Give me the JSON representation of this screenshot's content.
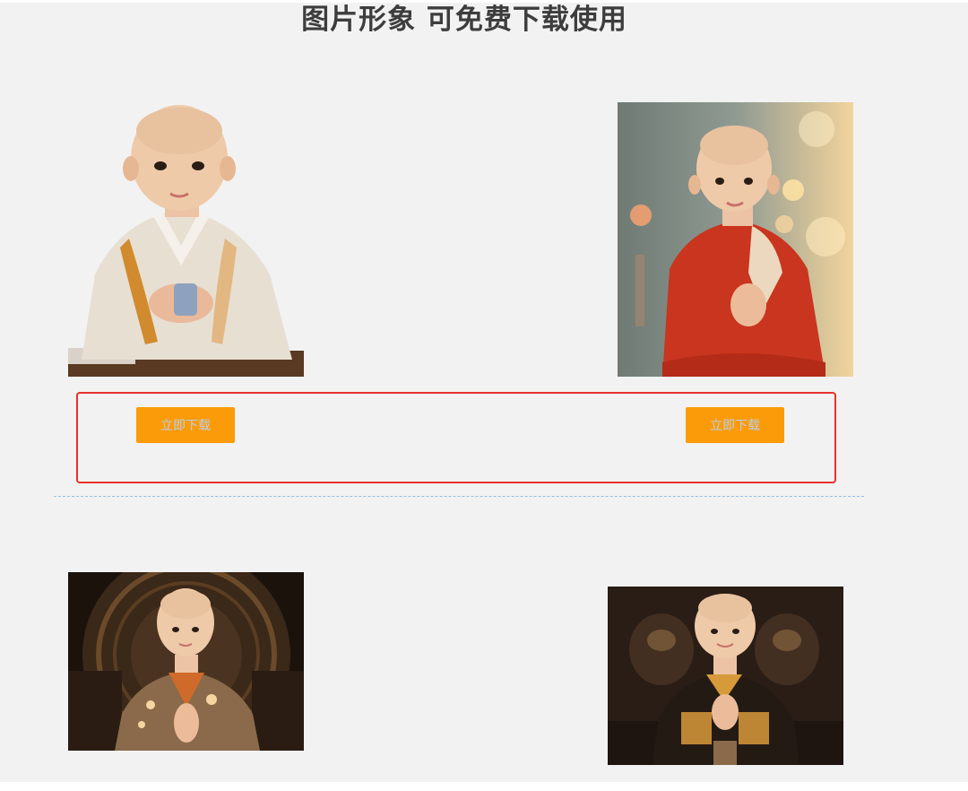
{
  "page": {
    "title": "图片形象 可免费下载使用"
  },
  "gallery": {
    "download_label": "立即下载",
    "cards": [
      {
        "name": "monk-child-white-robe",
        "robe_color": "#e7dfd2"
      },
      {
        "name": "monk-child-red-robe",
        "robe_color": "#c9351f"
      },
      {
        "name": "monk-child-brown-robe-temple",
        "robe_color": "#8a6a4a"
      },
      {
        "name": "monk-child-dark-robe",
        "robe_color": "#2a1f18"
      }
    ]
  },
  "colors": {
    "button_bg": "#fb9b09",
    "highlight_border": "#e8332a",
    "divider": "#8cc3f0",
    "background": "#f2f2f2"
  }
}
